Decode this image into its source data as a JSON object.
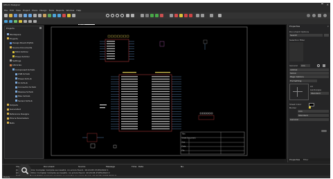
{
  "app": {
    "title": "Altium Designer",
    "accent": "#d9c33a"
  },
  "menu": [
    "File",
    "Edit",
    "View",
    "Project",
    "Place",
    "Design",
    "Tools",
    "Reports",
    "Window",
    "Help"
  ],
  "toolbar": {
    "zoom_label": "Zoom",
    "schematic_tab": "Schematic"
  },
  "projects_panel": {
    "title": "Projects",
    "items": [
      {
        "label": "Workspace",
        "icon": "workspace-icon",
        "depth": 0
      },
      {
        "label": "Projects",
        "icon": "folder-icon",
        "depth": 0
      },
      {
        "label": "Design Board.PrjPcb",
        "icon": "project-icon",
        "depth": 1
      },
      {
        "label": "Source Documents",
        "icon": "folder-icon",
        "depth": 1
      },
      {
        "label": "MCU.SchDoc",
        "icon": "schematic-icon",
        "depth": 2
      },
      {
        "label": "Power.SchDoc",
        "icon": "schematic-icon",
        "depth": 2
      },
      {
        "label": "Settings",
        "icon": "settings-icon",
        "depth": 1
      },
      {
        "label": "Libraries",
        "icon": "library-icon",
        "depth": 1
      },
      {
        "label": "Component.SchLib",
        "icon": "schlib-icon",
        "depth": 2
      },
      {
        "label": "USB.SchLib",
        "icon": "schlib-icon",
        "depth": 3
      },
      {
        "label": "Power.SchLib",
        "icon": "schlib-icon",
        "depth": 3
      },
      {
        "label": "IC.SchLib",
        "icon": "schlib-icon",
        "depth": 3
      },
      {
        "label": "Connector.SchLib",
        "icon": "schlib-icon",
        "depth": 3
      },
      {
        "label": "Passive.SchLib",
        "icon": "schlib-icon",
        "depth": 3
      },
      {
        "label": "Misc.SchLib",
        "icon": "schlib-icon",
        "depth": 3
      },
      {
        "label": "Sensor.SchLib",
        "icon": "schlib-icon",
        "depth": 3
      },
      {
        "label": "Outputs",
        "icon": "folder-icon",
        "depth": 0
      },
      {
        "label": "Generated",
        "icon": "folder-icon",
        "depth": 0
      },
      {
        "label": "Reference Designs",
        "icon": "folder-icon",
        "depth": 0
      },
      {
        "label": "Pins & Parameters",
        "icon": "folder-icon",
        "depth": 0
      },
      {
        "label": "Nets",
        "icon": "folder-icon",
        "depth": 0
      }
    ]
  },
  "canvas": {
    "title_block_labels": [
      "Title",
      "Sheet Document",
      "Size",
      "Date",
      "File"
    ]
  },
  "properties_panel": {
    "title": "Properties",
    "fields": {
      "search": "Search",
      "document_options": "Document Options",
      "selection_filter": "Selection Filter",
      "general": "General",
      "units": "mm",
      "visible_grid": "100mil",
      "snap_grid": "50mil",
      "page_options": "Page Options",
      "formatting": "Formatting",
      "sheet_size": "A4",
      "orientation": "Landscape",
      "title_block": "Standard",
      "sheet_color": "Sheet Color",
      "border": "Border"
    }
  },
  "panel_tabs": [
    "Properties",
    "Filter"
  ],
  "messages": {
    "columns": [
      "Class",
      "Document",
      "Source",
      "Message",
      "Time",
      "Date",
      "No."
    ],
    "rows": [
      "[Info]  MCU.SchDoc  Compiler  Compile successful, no errors found.  10:24:05  27/05/2022  1",
      "[Info]  Power.SchDoc  Compiler  Compile successful, no errors found.  10:24:06  27/05/2022  2",
      "[Info]  Design Board.PrjPcb  Compiler  Compile successful, no errors found.  10:24:06  27/05/2022  3"
    ]
  },
  "status": {
    "text": "Ready"
  }
}
